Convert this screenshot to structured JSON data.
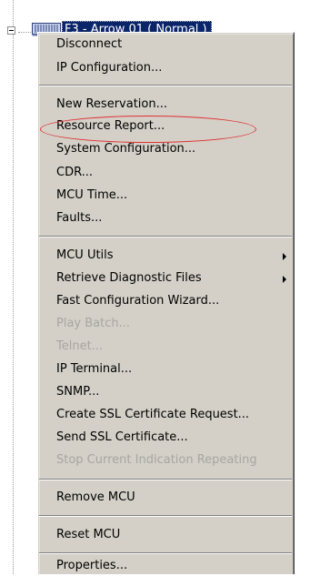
{
  "tree": {
    "node_label": "F3 - Arrow 01   ( Normal )",
    "expander_icon": "minus-box-icon",
    "node_icon": "mcu-device-icon"
  },
  "menu": {
    "items": [
      {
        "label": "Disconnect",
        "enabled": true
      },
      {
        "label": "IP Configuration...",
        "enabled": true
      },
      {
        "label": "New Reservation...",
        "enabled": true
      },
      {
        "label": "Resource Report...",
        "enabled": true,
        "highlighted_by_annotation": true
      },
      {
        "label": "System Configuration...",
        "enabled": true
      },
      {
        "label": "CDR...",
        "enabled": true
      },
      {
        "label": "MCU Time...",
        "enabled": true
      },
      {
        "label": "Faults...",
        "enabled": true
      },
      {
        "label": "MCU Utils",
        "enabled": true,
        "submenu": true
      },
      {
        "label": "Retrieve Diagnostic Files",
        "enabled": true,
        "submenu": true
      },
      {
        "label": "Fast Configuration Wizard...",
        "enabled": true
      },
      {
        "label": "Play Batch...",
        "enabled": false
      },
      {
        "label": "Telnet...",
        "enabled": false
      },
      {
        "label": "IP Terminal...",
        "enabled": true
      },
      {
        "label": "SNMP...",
        "enabled": true
      },
      {
        "label": "Create SSL Certificate Request...",
        "enabled": true
      },
      {
        "label": "Send SSL Certificate...",
        "enabled": true
      },
      {
        "label": "Stop Current Indication Repeating",
        "enabled": false
      },
      {
        "label": "Remove MCU",
        "enabled": true
      },
      {
        "label": "Reset MCU",
        "enabled": true
      },
      {
        "label": "Properties...",
        "enabled": true
      }
    ]
  },
  "colors": {
    "selection_bg": "#0a246a",
    "menu_bg": "#d4d0c8",
    "disabled_text": "#a8a5a0",
    "annotation": "#e03030"
  }
}
